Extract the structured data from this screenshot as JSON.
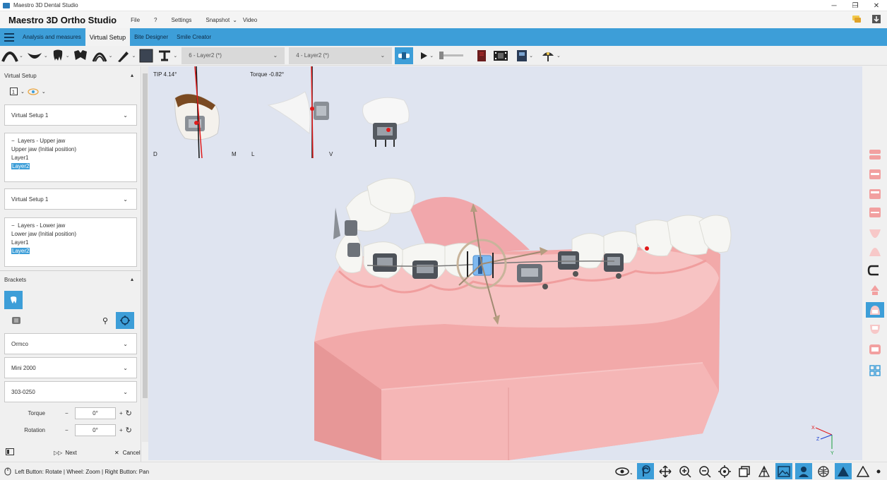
{
  "window": {
    "title": "Maestro 3D Dental Studio",
    "controls": [
      "─",
      "❐",
      "✕"
    ]
  },
  "menubar": {
    "brand": "Maestro 3D Ortho Studio",
    "items": [
      "File",
      "?",
      "Settings",
      "Snapshot",
      "Video"
    ],
    "snapshot_caret": "⌄"
  },
  "tabs": [
    "Analysis and measures",
    "Virtual Setup",
    "Bite Designer",
    "Smile Creator"
  ],
  "toolbar": {
    "combo_upper": "6 - Layer2 (*)",
    "combo_lower": "4 - Layer2 (*)",
    "caret": "⌄"
  },
  "sidebar": {
    "virtual_setup_header": "Virtual Setup",
    "upper_setup_select": "Virtual Setup 1",
    "upper_layers": {
      "title": "Layers - Upper jaw",
      "items": [
        "Upper jaw (Initial position)",
        "Layer1",
        "Layer2"
      ],
      "selected": "Layer2"
    },
    "lower_setup_select": "Virtual Setup 1",
    "lower_layers": {
      "title": "Layers - Lower jaw",
      "items": [
        "Lower jaw (Initial position)",
        "Layer1",
        "Layer2"
      ],
      "selected": "Layer2"
    },
    "brackets_header": "Brackets",
    "manufacturer": "Ormco",
    "model": "Mini 2000",
    "reference": "303-0250",
    "torque_label": "Torque",
    "torque_value": "0°",
    "rotation_label": "Rotation",
    "rotation_value": "0°",
    "minus": "−",
    "plus": "+",
    "next_label": "Next",
    "cancel_label": "Cancel"
  },
  "viewport": {
    "tip_label": "TIP 4.14°",
    "torque_label": "Torque -0.82°",
    "dm_left": "D",
    "dm_right": "M",
    "lv_left": "L",
    "lv_right": "V",
    "axis_x": "X",
    "axis_y": "Y",
    "axis_z": "Z"
  },
  "statusbar": {
    "hint": "Left Button: Rotate | Wheel: Zoom | Right Button: Pan"
  },
  "colors": {
    "accent": "#3d9ed8",
    "gum": "#f3b5b5",
    "background": "#dfe4f0"
  }
}
